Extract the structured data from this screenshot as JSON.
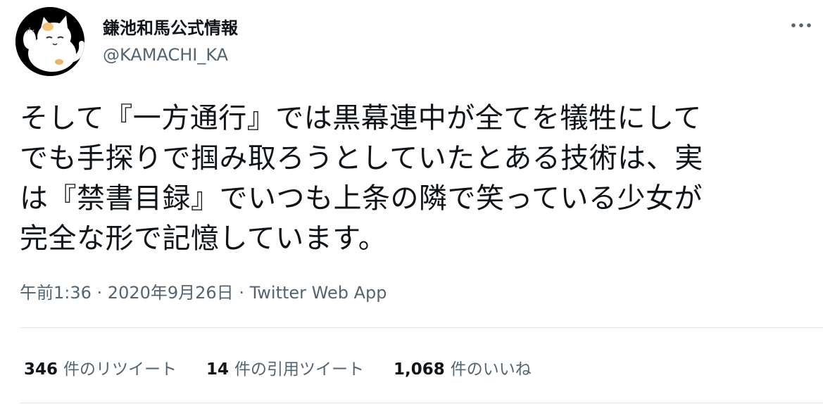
{
  "author": {
    "display_name": "鎌池和馬公式情報",
    "handle": "@KAMACHI_KA",
    "avatar_icon": "cat-character-avatar"
  },
  "more_icon": "more-horizontal-icon",
  "tweet": {
    "lines": [
      "そして『一方通行』では黒幕連中が全てを犠牲にして",
      "でも手探りで掴み取ろうとしていたとある技術は、実",
      "は『禁書目録』でいつも上条の隣で笑っている少女が",
      "完全な形で記憶しています。"
    ]
  },
  "meta": {
    "time": "午前1:36",
    "separator": " · ",
    "date": "2020年9月26日",
    "source": "Twitter Web App"
  },
  "stats": {
    "retweets": {
      "count": "346",
      "label": "件のリツイート"
    },
    "quotes": {
      "count": "14",
      "label": "件の引用ツイート"
    },
    "likes": {
      "count": "1,068",
      "label": "件のいいね"
    }
  },
  "colors": {
    "text_primary": "#0f1419",
    "text_secondary": "#536471",
    "divider": "#e3e8ec"
  }
}
